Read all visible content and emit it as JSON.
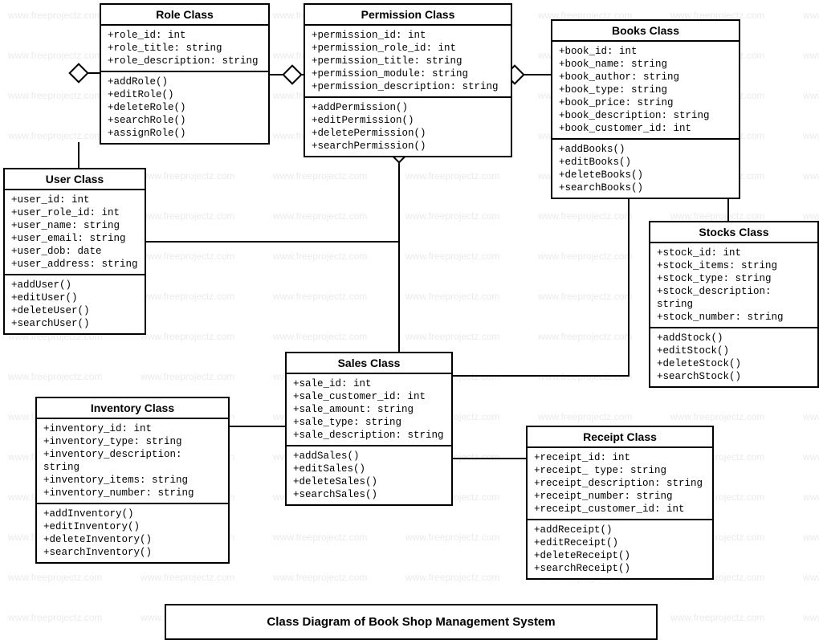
{
  "watermark": "www.freeprojectz.com",
  "caption": "Class Diagram of Book Shop Management System",
  "classes": {
    "role": {
      "title": "Role Class",
      "attrs": [
        "+role_id: int",
        "+role_title: string",
        "+role_description: string"
      ],
      "methods": [
        "+addRole()",
        "+editRole()",
        "+deleteRole()",
        "+searchRole()",
        "+assignRole()"
      ]
    },
    "permission": {
      "title": "Permission Class",
      "attrs": [
        "+permission_id: int",
        "+permission_role_id: int",
        "+permission_title: string",
        "+permission_module: string",
        "+permission_description: string"
      ],
      "methods": [
        "+addPermission()",
        "+editPermission()",
        "+deletePermission()",
        "+searchPermission()"
      ]
    },
    "books": {
      "title": "Books Class",
      "attrs": [
        "+book_id: int",
        "+book_name: string",
        "+book_author: string",
        "+book_type: string",
        "+book_price: string",
        "+book_description: string",
        "+book_customer_id: int"
      ],
      "methods": [
        "+addBooks()",
        "+editBooks()",
        "+deleteBooks()",
        "+searchBooks()"
      ]
    },
    "user": {
      "title": "User Class",
      "attrs": [
        "+user_id: int",
        "+user_role_id: int",
        "+user_name: string",
        "+user_email: string",
        "+user_dob: date",
        "+user_address: string"
      ],
      "methods": [
        "+addUser()",
        "+editUser()",
        "+deleteUser()",
        "+searchUser()"
      ]
    },
    "stocks": {
      "title": "Stocks Class",
      "attrs": [
        "+stock_id: int",
        "+stock_items: string",
        "+stock_type: string",
        "+stock_description: string",
        "+stock_number: string"
      ],
      "methods": [
        "+addStock()",
        "+editStock()",
        "+deleteStock()",
        "+searchStock()"
      ]
    },
    "sales": {
      "title": "Sales Class",
      "attrs": [
        "+sale_id: int",
        "+sale_customer_id: int",
        "+sale_amount: string",
        "+sale_type: string",
        "+sale_description: string"
      ],
      "methods": [
        "+addSales()",
        "+editSales()",
        "+deleteSales()",
        "+searchSales()"
      ]
    },
    "inventory": {
      "title": "Inventory Class",
      "attrs": [
        "+inventory_id: int",
        "+inventory_type: string",
        "+inventory_description: string",
        "+inventory_items: string",
        "+inventory_number: string"
      ],
      "methods": [
        "+addInventory()",
        "+editInventory()",
        "+deleteInventory()",
        "+searchInventory()"
      ]
    },
    "receipt": {
      "title": "Receipt Class",
      "attrs": [
        "+receipt_id: int",
        "+receipt_ type: string",
        "+receipt_description: string",
        "+receipt_number: string",
        "+receipt_customer_id: int"
      ],
      "methods": [
        "+addReceipt()",
        "+editReceipt()",
        "+deleteReceipt()",
        "+searchReceipt()"
      ]
    }
  }
}
